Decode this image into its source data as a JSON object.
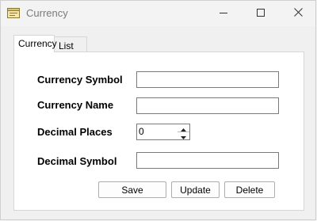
{
  "window": {
    "title": "Currency",
    "app_icon": "window-form-icon",
    "controls": [
      "minimize-icon",
      "maximize-icon",
      "close-icon"
    ]
  },
  "tabs": [
    {
      "label": "Currency",
      "selected": true
    },
    {
      "label": "List",
      "selected": false
    }
  ],
  "form": {
    "currency_symbol": {
      "label": "Currency Symbol",
      "value": ""
    },
    "currency_name": {
      "label": "Currency Name",
      "value": ""
    },
    "decimal_places": {
      "label": "Decimal Places",
      "value": "0"
    },
    "decimal_symbol": {
      "label": "Decimal Symbol",
      "value": ""
    }
  },
  "buttons": {
    "save": "Save",
    "update": "Update",
    "delete": "Delete"
  }
}
